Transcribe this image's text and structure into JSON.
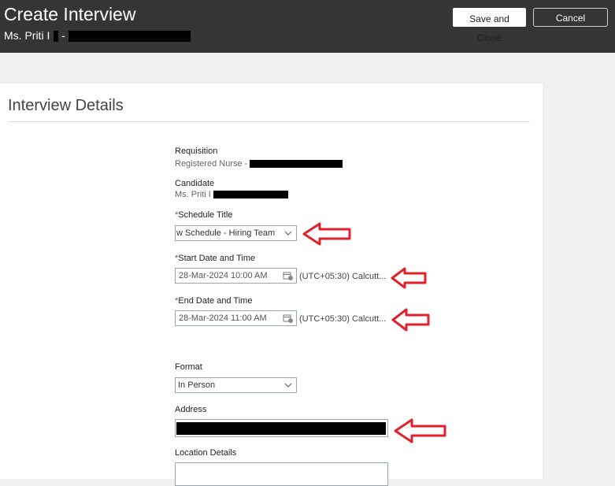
{
  "header": {
    "title": "Create Interview",
    "subtitle": "Ms. Priti I",
    "subtitle_sep": "-",
    "save_label": "Save and Close",
    "cancel_label": "Cancel"
  },
  "panel": {
    "title": "Interview Details"
  },
  "requisition": {
    "label": "Requisition",
    "value": "Registered Nurse -"
  },
  "candidate": {
    "label": "Candidate",
    "value": "Ms. Priti I"
  },
  "schedule_title": {
    "required_mark": "*",
    "label": "Schedule Title",
    "value": "w Schedule - Hiring Team"
  },
  "start": {
    "required_mark": "*",
    "label": "Start Date and Time",
    "value": "28-Mar-2024 10:00 AM",
    "timezone": "(UTC+05:30) Calcutt..."
  },
  "end": {
    "required_mark": "*",
    "label": "End Date and Time",
    "value": "28-Mar-2024 11:00 AM",
    "timezone": "(UTC+05:30) Calcutt..."
  },
  "format": {
    "label": "Format",
    "value": "In Person"
  },
  "address": {
    "label": "Address",
    "value": ""
  },
  "location_details": {
    "label": "Location Details",
    "value": ""
  },
  "colors": {
    "header_bg": "#353535",
    "required": "#1565c0",
    "arrow": "#e0202a"
  },
  "icons": [
    "chevron-down-icon",
    "calendar-icon",
    "red-arrow-annotation"
  ]
}
